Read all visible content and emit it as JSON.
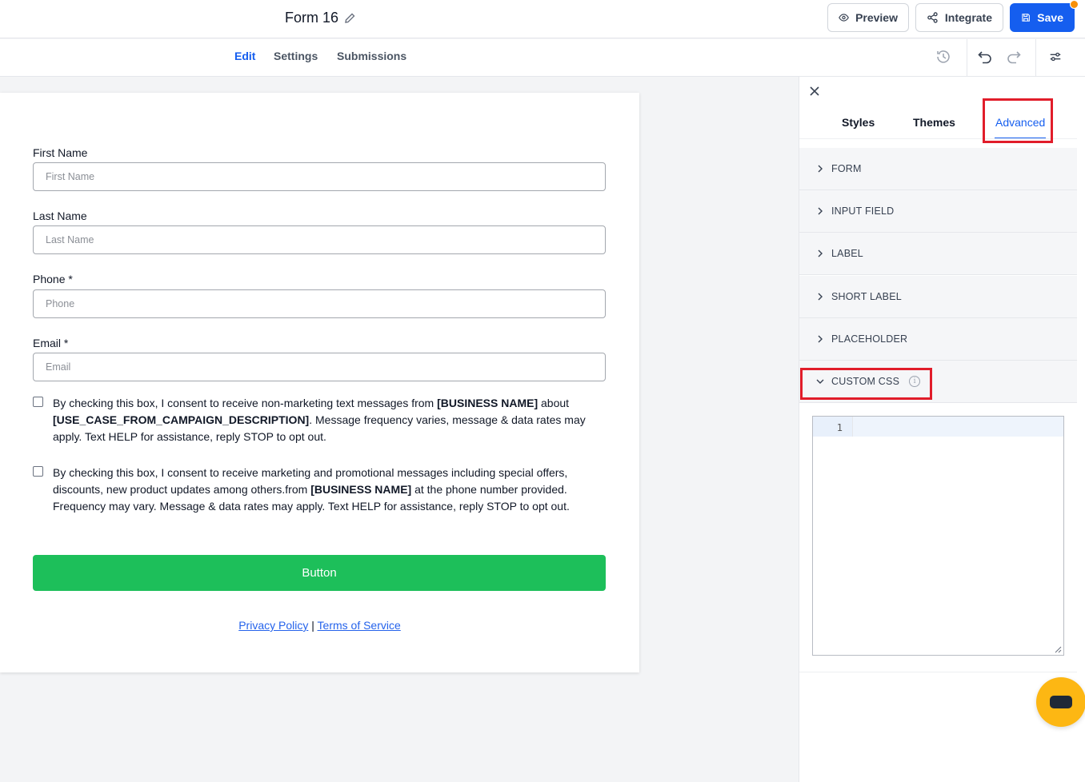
{
  "header": {
    "form_title": "Form 16",
    "preview_label": "Preview",
    "integrate_label": "Integrate",
    "save_label": "Save"
  },
  "nav_tabs": [
    {
      "label": "Edit",
      "active": true
    },
    {
      "label": "Settings",
      "active": false
    },
    {
      "label": "Submissions",
      "active": false
    }
  ],
  "form": {
    "fields": [
      {
        "label": "First Name",
        "placeholder": "First Name"
      },
      {
        "label": "Last Name",
        "placeholder": "Last Name"
      },
      {
        "label": "Phone *",
        "placeholder": "Phone"
      },
      {
        "label": "Email *",
        "placeholder": "Email"
      }
    ],
    "consent_1": {
      "t1": "By checking this box, I consent to receive non-marketing text messages from ",
      "b1": "[BUSINESS NAME]",
      "t2": " about ",
      "b2": "[USE_CASE_FROM_CAMPAIGN_DESCRIPTION]",
      "t3": ". Message frequency varies, message & data rates may apply. Text HELP for assistance, reply STOP to opt out."
    },
    "consent_2": {
      "t1": "By checking this box, I consent to receive marketing and promotional messages including special offers, discounts, new product updates among others.from ",
      "b1": "[BUSINESS NAME]",
      "t2": " at the phone number provided. Frequency may vary. Message & data rates may apply. Text HELP for assistance, reply STOP to opt out."
    },
    "button_label": "Button",
    "privacy_label": "Privacy Policy",
    "separator": "|",
    "terms_label": "Terms of Service"
  },
  "panel": {
    "tabs": [
      {
        "label": "Styles",
        "active": false
      },
      {
        "label": "Themes",
        "active": false
      },
      {
        "label": "Advanced",
        "active": true
      }
    ],
    "sections": [
      "FORM",
      "INPUT FIELD",
      "LABEL",
      "SHORT LABEL",
      "PLACEHOLDER"
    ],
    "custom_css_label": "CUSTOM CSS",
    "info_glyph": "i",
    "editor_line_number": "1",
    "highlight_color": "#e11d2a"
  },
  "colors": {
    "primary": "#155eef",
    "submit_button": "#1dbf5a",
    "chat_fab": "#fdb713"
  }
}
